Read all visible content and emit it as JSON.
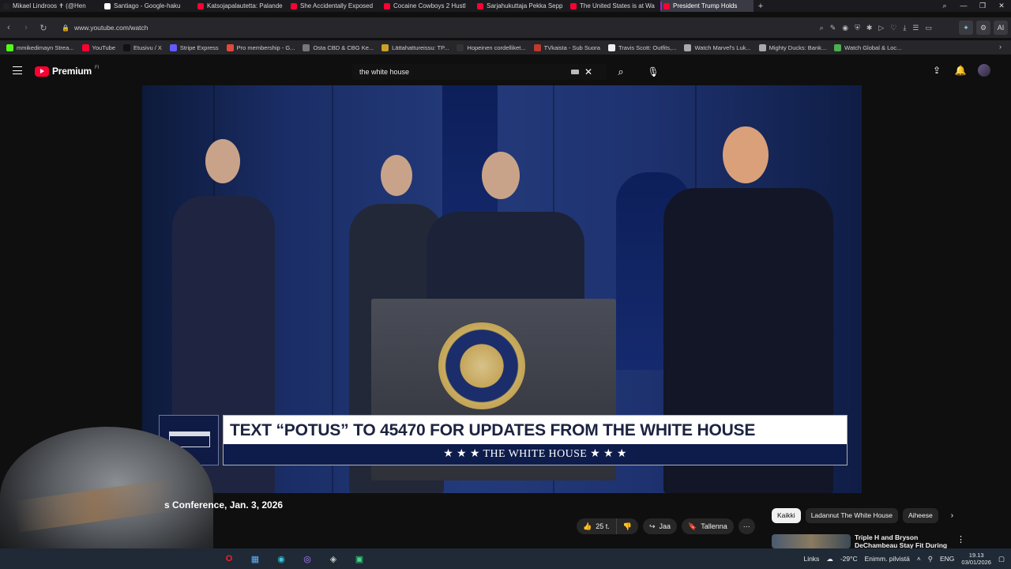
{
  "browser": {
    "tabs": [
      {
        "label": "Mikael Lindroos ✝ (@Hen",
        "color": "#222",
        "icon": "x-icon"
      },
      {
        "label": "Santiago - Google-haku",
        "color": "#fff",
        "icon": "google-icon"
      },
      {
        "label": "Katsojapalautetta: Palande",
        "color": "#ff0033",
        "icon": "youtube-icon"
      },
      {
        "label": "She Accidentally Exposed",
        "color": "#ff0033",
        "icon": "youtube-icon"
      },
      {
        "label": "Cocaine Cowboys 2 Hustl",
        "color": "#ff0033",
        "icon": "youtube-icon"
      },
      {
        "label": "Sarjahukuttaja Pekka Sepp",
        "color": "#ff0033",
        "icon": "youtube-icon"
      },
      {
        "label": "The United States is at Wa",
        "color": "#ff0033",
        "icon": "youtube-icon"
      },
      {
        "label": "President Trump Holds",
        "color": "#ff0033",
        "icon": "youtube-icon",
        "active": true
      }
    ],
    "url": "www.youtube.com/watch",
    "bookmarks": [
      {
        "label": "mmikedimayn Strea...",
        "color": "#53fc18"
      },
      {
        "label": "YouTube",
        "color": "#ff0033"
      },
      {
        "label": "Etusivu / X",
        "color": "#111"
      },
      {
        "label": "Stripe Express",
        "color": "#635bff"
      },
      {
        "label": "Pro membership - G...",
        "color": "#e04a3a"
      },
      {
        "label": "Osta CBD & CBG Ke...",
        "color": "#777"
      },
      {
        "label": "Lättahattureissu: TP...",
        "color": "#c9a227"
      },
      {
        "label": "Hopeinen cordelliket...",
        "color": "#333"
      },
      {
        "label": "TVkaista - Sub Suora",
        "color": "#c0392b"
      },
      {
        "label": "Travis Scott: Outfits,...",
        "color": "#eee"
      },
      {
        "label": "Watch Marvel's Luk...",
        "color": "#aaa"
      },
      {
        "label": "Mighty Ducks: Bank...",
        "color": "#aaa"
      },
      {
        "label": "Watch Global & Loc...",
        "color": "#4caf50"
      }
    ]
  },
  "youtube": {
    "logo_text": "Premium",
    "logo_region": "FI",
    "search_value": "the white house"
  },
  "video": {
    "banner_text": "TEXT “POTUS” TO 45470 FOR UPDATES FROM THE WHITE HOUSE",
    "banner_subtext": "★ ★ ★   THE WHITE HOUSE   ★ ★ ★",
    "title": "s Conference, Jan. 3, 2026"
  },
  "actions": {
    "like_count": "25 t.",
    "share": "Jaa",
    "save": "Tallenna"
  },
  "chips": [
    "Kaikki",
    "Ladannut The White House",
    "Aiheese"
  ],
  "recommendation": {
    "title": "Triple H and Bryson DeChambeau Stay Fit During"
  },
  "taskbar": {
    "links": "Links",
    "weather": "-29°C",
    "weather_desc": "Enimm. pilvistä",
    "lang": "ENG",
    "time": "19.13",
    "date": "03/01/2026"
  }
}
